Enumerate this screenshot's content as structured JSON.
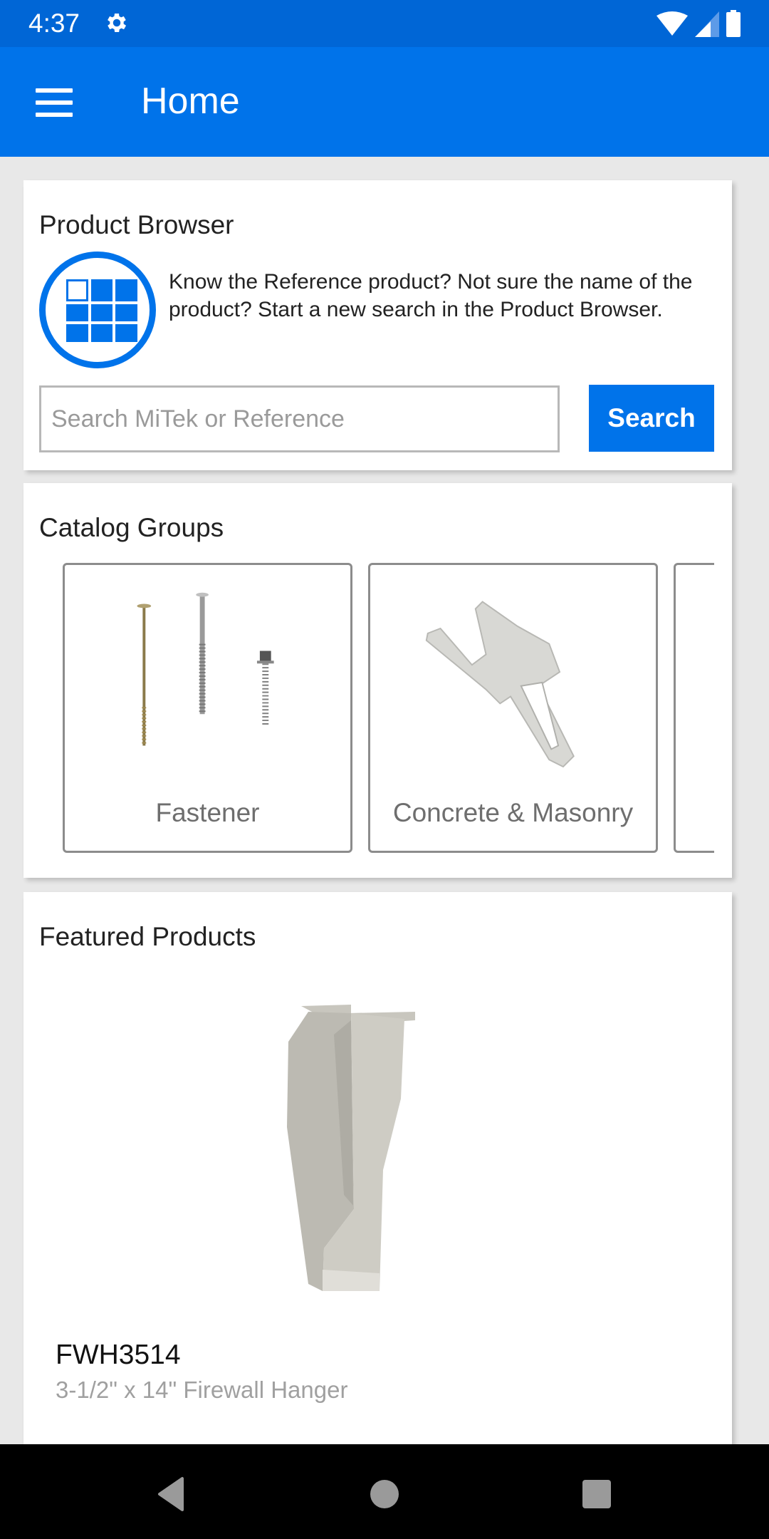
{
  "status_bar": {
    "time": "4:37",
    "icons": [
      "settings-gear-icon",
      "wifi-icon",
      "cellular-signal-icon",
      "battery-icon"
    ]
  },
  "app_bar": {
    "title": "Home",
    "menu_icon": "hamburger-menu-icon"
  },
  "product_browser": {
    "title": "Product Browser",
    "icon": "grid-browser-icon",
    "description": "Know the Reference product? Not sure the name of the product? Start a new search in the Product Browser.",
    "search_placeholder": "Search MiTek or Reference",
    "search_value": "",
    "search_button": "Search"
  },
  "catalog_groups": {
    "title": "Catalog Groups",
    "items": [
      {
        "label": "Fastener",
        "image": "fasteners-screws-image"
      },
      {
        "label": "Concrete & Masonry",
        "image": "masonry-anchor-strap-image"
      },
      {
        "label": "",
        "image": ""
      }
    ]
  },
  "featured_products": {
    "title": "Featured Products",
    "items": [
      {
        "code": "FWH3514",
        "description": "3-1/2\" x 14\" Firewall Hanger",
        "image": "firewall-hanger-image"
      }
    ]
  },
  "nav_bar": {
    "buttons": [
      "back-icon",
      "home-icon",
      "recents-icon"
    ]
  },
  "colors": {
    "status_bar": "#0066d6",
    "app_bar": "#0073ea",
    "accent": "#0073ea",
    "background": "#e8e8e8"
  }
}
